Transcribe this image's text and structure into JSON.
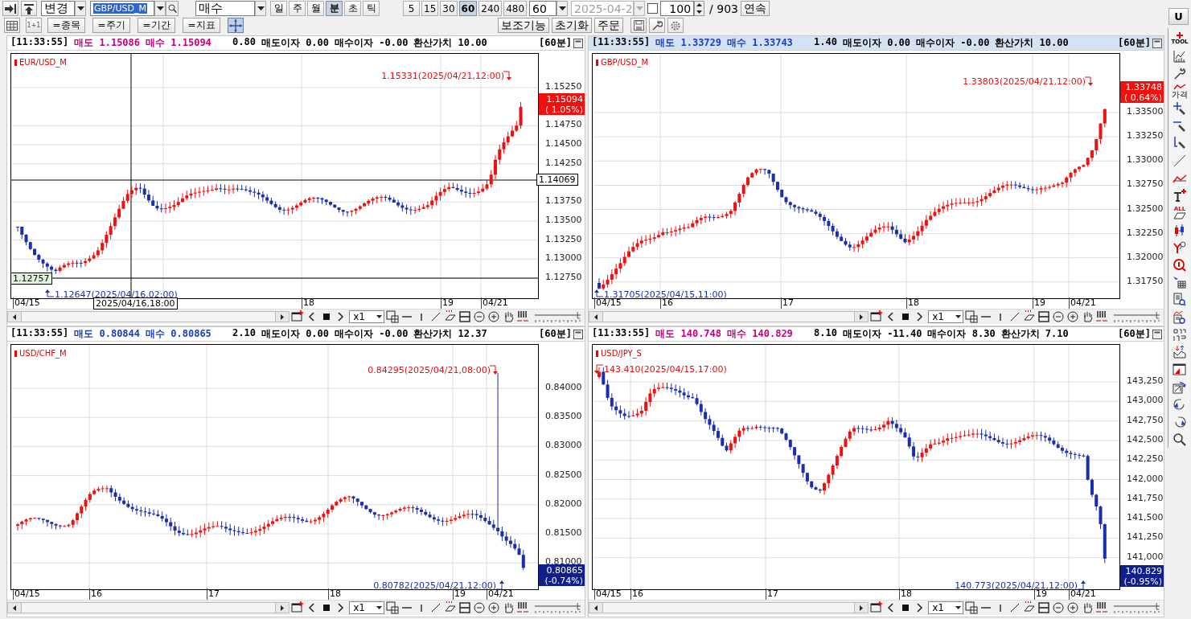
{
  "toolbar": {
    "symbol_mode": "변경",
    "symbol": {
      "value": "GBP/USD_M",
      "highlighted": true
    },
    "side": "매수",
    "periods": [
      {
        "label": "일",
        "selected": false
      },
      {
        "label": "주",
        "selected": false
      },
      {
        "label": "월",
        "selected": false
      },
      {
        "label": "분",
        "selected": true
      },
      {
        "label": "초",
        "selected": false
      },
      {
        "label": "틱",
        "selected": false
      }
    ],
    "intervals": [
      {
        "label": "5",
        "selected": false
      },
      {
        "label": "15",
        "selected": false
      },
      {
        "label": "30",
        "selected": false
      },
      {
        "label": "60",
        "selected": true
      },
      {
        "label": "240",
        "selected": false
      },
      {
        "label": "480",
        "selected": false
      }
    ],
    "interval_value": "60",
    "date": {
      "value": "2025-04-2",
      "disabled": true
    },
    "sync": {
      "checked": false
    },
    "count": "100",
    "total": "/ 903",
    "continue_button": "연속",
    "layout_button": "1+1",
    "filters": [
      "=종목",
      "=주기",
      "=기간",
      "=지표"
    ],
    "crosshair_mode": {
      "on": true
    },
    "actions": [
      "보조기능",
      "초기화",
      "주문"
    ]
  },
  "panels": [
    {
      "time": "[11:33:55]",
      "bid": "매도 1.15086",
      "ask": "매수 1.15094",
      "color": "#c8007c",
      "spread": "0.80",
      "bid_interest": "매도이자 0.00",
      "ask_interest": "매수이자 -0.00",
      "value": "환산가치 10.00",
      "period": "[60분]",
      "selected": false,
      "symbol": "EUR/USD_M",
      "high": "1.15331(2025/04/21,12:00)",
      "low": "1.12647(2025/04/16,02:00)",
      "yticks": [
        "1.15250",
        "1.14750",
        "1.14500",
        "1.14250",
        "1.13750",
        "1.13500",
        "1.13250",
        "1.13000",
        "1.12750"
      ],
      "price_tag": {
        "price": "1.15094",
        "change": "( 1.05%)",
        "color": "#f01010"
      },
      "slider": {
        "level": 0.95
      },
      "xlabels": [
        "04/15",
        "18",
        "19",
        "04/21"
      ],
      "crosshair": {
        "value": "1.14069",
        "left_value": "1.12757",
        "date": "2025/04/16,18:00"
      },
      "zoom": "x1"
    },
    {
      "time": "[11:33:55]",
      "bid": "매도 1.33729",
      "ask": "매수 1.33743",
      "color": "#1a3cc8",
      "spread": "1.40",
      "bid_interest": "매도이자 0.00",
      "ask_interest": "매수이자 -0.00",
      "value": "환산가치 10.00",
      "period": "[60분]",
      "selected": true,
      "symbol": "GBP/USD_M",
      "high": "1.33803(2025/04/21,12:00)",
      "low": "1.31705(2025/04/15,11:00)",
      "yticks": [
        "1.33500",
        "1.33250",
        "1.33000",
        "1.32750",
        "1.32500",
        "1.32250",
        "1.32000",
        "1.31750"
      ],
      "price_tag": {
        "price": "1.33748",
        "change": "( 0.64%)",
        "color": "#f01010"
      },
      "slider": {
        "level": 0.95
      },
      "xlabels": [
        "04/15",
        "16",
        "17",
        "18",
        "19",
        "04/21"
      ],
      "zoom": "x1"
    },
    {
      "time": "[11:33:55]",
      "bid": "매도 0.80844",
      "ask": "매수 0.80865",
      "color": "#1a3cc8",
      "spread": "2.10",
      "bid_interest": "매도이자 0.00",
      "ask_interest": "매수이자 -0.00",
      "value": "환산가치 12.37",
      "period": "[60분]",
      "selected": false,
      "symbol": "USD/CHF_M",
      "high": "0.84295(2025/04/21,08:00)",
      "low": "0.80782(2025/04/21,12:00)",
      "yticks": [
        "0.84000",
        "0.83500",
        "0.83000",
        "0.82500",
        "0.82000",
        "0.81500",
        "0.81000"
      ],
      "price_tag": {
        "price": "0.80865",
        "change": "(-0.74%)",
        "color": "#0f1f8c"
      },
      "slider": {
        "level": 0.95
      },
      "xlabels": [
        "04/15",
        "16",
        "17",
        "18",
        "19",
        "04/21"
      ],
      "zoom": "x1"
    },
    {
      "time": "[11:33:55]",
      "bid": "매도 140.748",
      "ask": "매수 140.829",
      "color": "#c8007c",
      "spread": "8.10",
      "bid_interest": "매도이자 -11.40",
      "ask_interest": "매수이자 8.30",
      "value": "환산가치 7.10",
      "period": "[60분]",
      "selected": false,
      "symbol": "USD/JPY_S",
      "high": "143.410(2025/04/15,17:00)",
      "low": "140.773(2025/04/21,12:00)",
      "yticks": [
        "143,250",
        "143,000",
        "142,750",
        "142,500",
        "142,250",
        "142,000",
        "141,750",
        "141,500",
        "141,250",
        "141,000"
      ],
      "price_tag": {
        "price": "140.829",
        "change": "(-0.95%)",
        "color": "#0f1f8c"
      },
      "slider": {
        "level": 0.95
      },
      "xlabels": [
        "04/15",
        "16",
        "17",
        "18",
        "19",
        "04/21"
      ],
      "zoom": "x1"
    }
  ],
  "sidebar": {
    "top_button": "U",
    "tools": [
      {
        "kind": "tool",
        "label": "TOOL"
      },
      {
        "kind": "chart"
      },
      {
        "kind": "wrench"
      },
      {
        "kind": "price",
        "label": "가격"
      },
      {
        "kind": "add-line"
      },
      {
        "kind": "remove-line"
      },
      {
        "kind": "vertical"
      },
      {
        "kind": "line"
      },
      {
        "kind": "trend"
      },
      {
        "kind": "text"
      },
      {
        "kind": "eraser",
        "label": "ALL"
      },
      {
        "kind": "candle"
      },
      {
        "kind": "axis"
      },
      {
        "kind": "magnify"
      },
      {
        "kind": "cursor"
      },
      {
        "kind": "doc-search"
      },
      {
        "kind": "chart-search"
      },
      {
        "kind": "pattern"
      },
      {
        "kind": "updown"
      },
      {
        "kind": "window"
      },
      {
        "kind": "export"
      },
      {
        "kind": "undo"
      },
      {
        "kind": "redo"
      },
      {
        "kind": "search"
      }
    ]
  }
}
